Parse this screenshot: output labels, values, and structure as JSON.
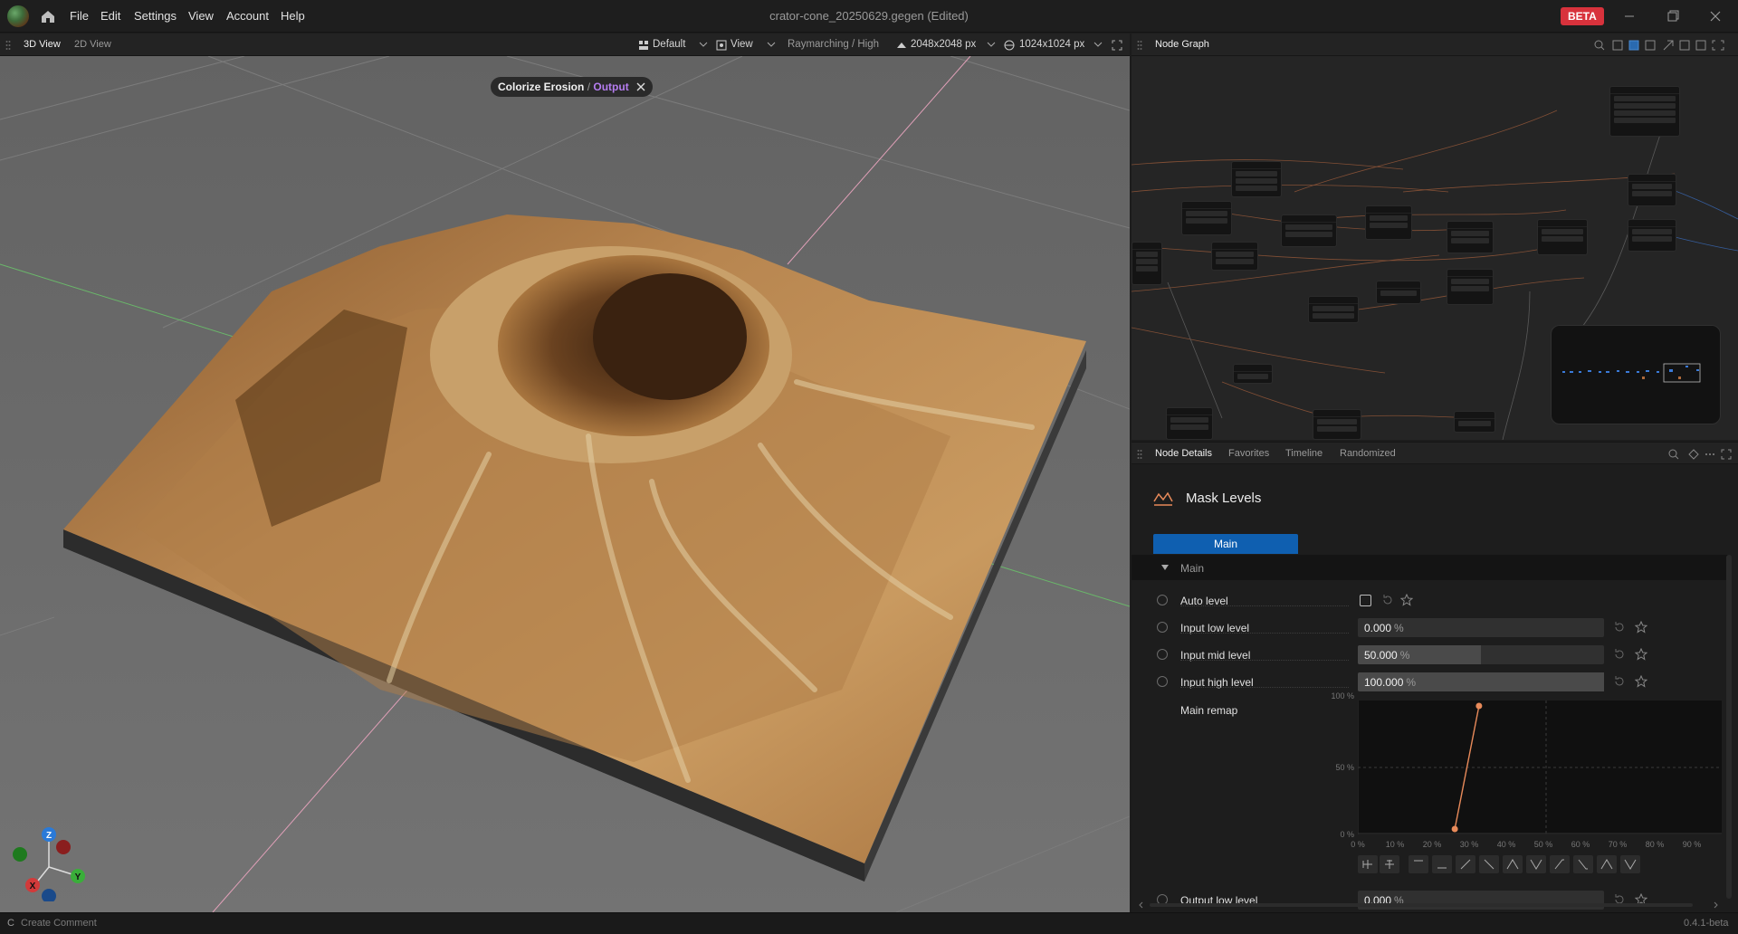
{
  "app": {
    "menu": [
      "File",
      "Edit",
      "Settings",
      "View",
      "Account",
      "Help"
    ],
    "doc_title": "crator-cone_20250629.gegen",
    "doc_status": "(Edited)",
    "beta_label": "BETA"
  },
  "viewport_toolbar": {
    "tabs": [
      "3D View",
      "2D View"
    ],
    "layout_label": "Default",
    "view_label": "View",
    "render_mode": "Raymarching / High",
    "resolution": "2048x2048 px",
    "preview_resolution": "1024x1024 px"
  },
  "viewport": {
    "breadcrumb_node": "Colorize Erosion",
    "breadcrumb_sep": "/",
    "breadcrumb_output": "Output",
    "axes": {
      "z": "Z",
      "y": "Y",
      "x": "X"
    }
  },
  "node_graph": {
    "title": "Node Graph"
  },
  "node_details": {
    "tabs": [
      "Node Details",
      "Favorites",
      "Timeline",
      "Randomized"
    ],
    "node_name": "Mask Levels",
    "sub_tab": "Main",
    "section": "Main",
    "params": [
      {
        "label": "Auto level",
        "type": "checkbox"
      },
      {
        "label": "Input low level",
        "value": "0.000",
        "unit": "%",
        "fraction": 0
      },
      {
        "label": "Input mid level",
        "value": "50.000",
        "unit": "%",
        "fraction": 0.5
      },
      {
        "label": "Input high level",
        "value": "100.000",
        "unit": "%",
        "fraction": 1.0
      },
      {
        "label": "Main remap",
        "type": "curve"
      },
      {
        "label": "Output low level",
        "value": "0.000",
        "unit": "%",
        "fraction": 0
      }
    ],
    "curve": {
      "y_ticks": [
        "100 %",
        "50 %",
        "0 %"
      ],
      "x_ticks": [
        "0 %",
        "10 %",
        "20 %",
        "30 %",
        "40 %",
        "50 %",
        "60 %",
        "70 %",
        "80 %",
        "90 %"
      ],
      "points": [
        [
          0.27,
          0.0
        ],
        [
          0.34,
          1.0
        ]
      ],
      "color": "#e88a5a"
    }
  },
  "statusbar": {
    "shortcut": "C",
    "hint": "Create Comment",
    "version": "0.4.1-beta"
  },
  "colors": {
    "accent_blue": "#0f5fb0",
    "beta_red": "#d8323c",
    "output_purple": "#b57df0",
    "axis_x": "#d23a3a",
    "axis_y": "#3aae3a",
    "axis_z": "#2a7ad8"
  }
}
